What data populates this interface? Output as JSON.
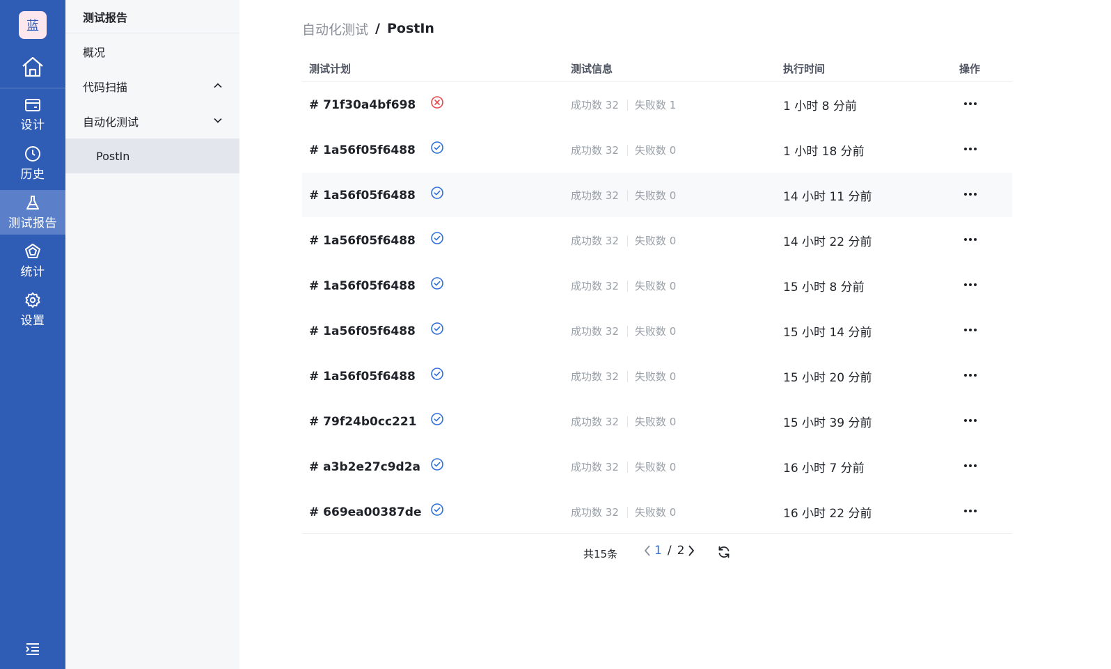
{
  "rail": {
    "logo_text": "蓝",
    "items": [
      {
        "label": "设计",
        "icon": "card-icon",
        "active": false
      },
      {
        "label": "历史",
        "icon": "clock-icon",
        "active": false
      },
      {
        "label": "测试报告",
        "icon": "flask-icon",
        "active": true
      },
      {
        "label": "统计",
        "icon": "radar-icon",
        "active": false
      },
      {
        "label": "设置",
        "icon": "gear-icon",
        "active": false
      }
    ],
    "accent_color": "#2f5cb5"
  },
  "subnav": {
    "title": "测试报告",
    "items": [
      {
        "label": "概况"
      },
      {
        "label": "代码扫描",
        "expanded": true
      },
      {
        "label": "自动化测试",
        "expanded": false
      },
      {
        "label": "PostIn",
        "selected": true
      }
    ]
  },
  "breadcrumb": {
    "parent": "自动化测试",
    "separator": "/",
    "current": "PostIn"
  },
  "table": {
    "headers": {
      "plan": "测试计划",
      "info": "测试信息",
      "time": "执行时间",
      "action": "操作"
    },
    "success_label": "成功数",
    "fail_label": "失败数",
    "rows": [
      {
        "id": "# 71f30a4bf698",
        "status": "failed",
        "success": "32",
        "fail": "1",
        "time": "1 小时 8 分前"
      },
      {
        "id": "# 1a56f05f6488",
        "status": "passed",
        "success": "32",
        "fail": "0",
        "time": "1 小时 18 分前"
      },
      {
        "id": "# 1a56f05f6488",
        "status": "passed",
        "success": "32",
        "fail": "0",
        "time": "14 小时 11 分前"
      },
      {
        "id": "# 1a56f05f6488",
        "status": "passed",
        "success": "32",
        "fail": "0",
        "time": "14 小时 22 分前"
      },
      {
        "id": "# 1a56f05f6488",
        "status": "passed",
        "success": "32",
        "fail": "0",
        "time": "15 小时 8 分前"
      },
      {
        "id": "# 1a56f05f6488",
        "status": "passed",
        "success": "32",
        "fail": "0",
        "time": "15 小时 14 分前"
      },
      {
        "id": "# 1a56f05f6488",
        "status": "passed",
        "success": "32",
        "fail": "0",
        "time": "15 小时 20 分前"
      },
      {
        "id": "# 79f24b0cc221",
        "status": "passed",
        "success": "32",
        "fail": "0",
        "time": "15 小时 39 分前"
      },
      {
        "id": "# a3b2e27c9d2a",
        "status": "passed",
        "success": "32",
        "fail": "0",
        "time": "16 小时 7 分前"
      },
      {
        "id": "# 669ea00387de",
        "status": "passed",
        "success": "32",
        "fail": "0",
        "time": "16 小时 22 分前"
      }
    ]
  },
  "pagination": {
    "total_text": "共15条",
    "current_page": "1",
    "separator": "/",
    "total_pages": "2"
  },
  "colors": {
    "passed": "#2f6fdb",
    "failed": "#e5484d"
  }
}
